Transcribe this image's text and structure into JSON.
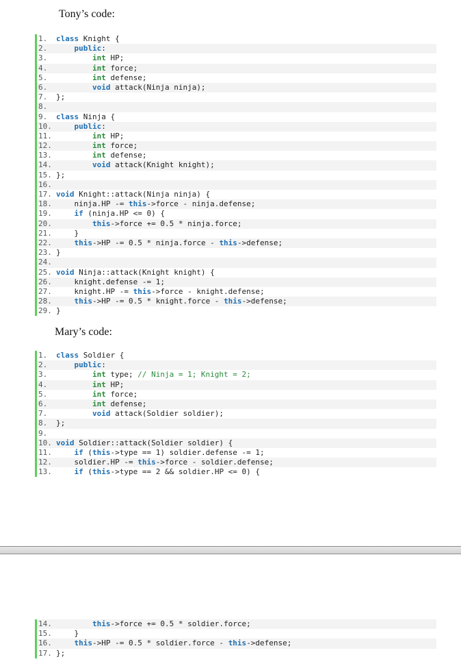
{
  "tony": {
    "title": "Tony’s code:",
    "start_line": 1,
    "lines": [
      [
        [
          "k",
          "class"
        ],
        [
          "t",
          " Knight {"
        ]
      ],
      [
        [
          "t",
          "    "
        ],
        [
          "k",
          "public"
        ],
        [
          "t",
          ":"
        ]
      ],
      [
        [
          "t",
          "        "
        ],
        [
          "y",
          "int"
        ],
        [
          "t",
          " HP;"
        ]
      ],
      [
        [
          "t",
          "        "
        ],
        [
          "y",
          "int"
        ],
        [
          "t",
          " force;"
        ]
      ],
      [
        [
          "t",
          "        "
        ],
        [
          "y",
          "int"
        ],
        [
          "t",
          " defense;"
        ]
      ],
      [
        [
          "t",
          "        "
        ],
        [
          "k",
          "void"
        ],
        [
          "t",
          " attack(Ninja ninja);"
        ]
      ],
      [
        [
          "t",
          "};"
        ]
      ],
      [],
      [
        [
          "k",
          "class"
        ],
        [
          "t",
          " Ninja {"
        ]
      ],
      [
        [
          "t",
          "    "
        ],
        [
          "k",
          "public"
        ],
        [
          "t",
          ":"
        ]
      ],
      [
        [
          "t",
          "        "
        ],
        [
          "y",
          "int"
        ],
        [
          "t",
          " HP;"
        ]
      ],
      [
        [
          "t",
          "        "
        ],
        [
          "y",
          "int"
        ],
        [
          "t",
          " force;"
        ]
      ],
      [
        [
          "t",
          "        "
        ],
        [
          "y",
          "int"
        ],
        [
          "t",
          " defense;"
        ]
      ],
      [
        [
          "t",
          "        "
        ],
        [
          "k",
          "void"
        ],
        [
          "t",
          " attack(Knight knight);"
        ]
      ],
      [
        [
          "t",
          "};"
        ]
      ],
      [],
      [
        [
          "k",
          "void"
        ],
        [
          "t",
          " Knight::attack(Ninja ninja) {"
        ]
      ],
      [
        [
          "t",
          "    ninja.HP -= "
        ],
        [
          "k",
          "this"
        ],
        [
          "t",
          "->force - ninja.defense;"
        ]
      ],
      [
        [
          "t",
          "    "
        ],
        [
          "k",
          "if"
        ],
        [
          "t",
          " (ninja.HP <= 0) {"
        ]
      ],
      [
        [
          "t",
          "        "
        ],
        [
          "k",
          "this"
        ],
        [
          "t",
          "->force += 0.5 * ninja.force;"
        ]
      ],
      [
        [
          "t",
          "    }"
        ]
      ],
      [
        [
          "t",
          "    "
        ],
        [
          "k",
          "this"
        ],
        [
          "t",
          "->HP -= 0.5 * ninja.force - "
        ],
        [
          "k",
          "this"
        ],
        [
          "t",
          "->defense;"
        ]
      ],
      [
        [
          "t",
          "}"
        ]
      ],
      [],
      [
        [
          "k",
          "void"
        ],
        [
          "t",
          " Ninja::attack(Knight knight) {"
        ]
      ],
      [
        [
          "t",
          "    knight.defense -= 1;"
        ]
      ],
      [
        [
          "t",
          "    knight.HP -= "
        ],
        [
          "k",
          "this"
        ],
        [
          "t",
          "->force - knight.defense;"
        ]
      ],
      [
        [
          "t",
          "    "
        ],
        [
          "k",
          "this"
        ],
        [
          "t",
          "->HP -= 0.5 * knight.force - "
        ],
        [
          "k",
          "this"
        ],
        [
          "t",
          "->defense;"
        ]
      ],
      [
        [
          "t",
          "}"
        ]
      ]
    ]
  },
  "mary": {
    "title": "Mary’s code:",
    "part1_start_line": 1,
    "part1": [
      [
        [
          "k",
          "class"
        ],
        [
          "t",
          " Soldier {"
        ]
      ],
      [
        [
          "t",
          "    "
        ],
        [
          "k",
          "public"
        ],
        [
          "t",
          ":"
        ]
      ],
      [
        [
          "t",
          "        "
        ],
        [
          "y",
          "int"
        ],
        [
          "t",
          " type; "
        ],
        [
          "c",
          "// Ninja = 1; Knight = 2;"
        ]
      ],
      [
        [
          "t",
          "        "
        ],
        [
          "y",
          "int"
        ],
        [
          "t",
          " HP;"
        ]
      ],
      [
        [
          "t",
          "        "
        ],
        [
          "y",
          "int"
        ],
        [
          "t",
          " force;"
        ]
      ],
      [
        [
          "t",
          "        "
        ],
        [
          "y",
          "int"
        ],
        [
          "t",
          " defense;"
        ]
      ],
      [
        [
          "t",
          "        "
        ],
        [
          "k",
          "void"
        ],
        [
          "t",
          " attack(Soldier soldier);"
        ]
      ],
      [
        [
          "t",
          "};"
        ]
      ],
      [],
      [
        [
          "k",
          "void"
        ],
        [
          "t",
          " Soldier::attack(Soldier soldier) {"
        ]
      ],
      [
        [
          "t",
          "    "
        ],
        [
          "k",
          "if"
        ],
        [
          "t",
          " ("
        ],
        [
          "k",
          "this"
        ],
        [
          "t",
          "->type == 1) soldier.defense -= 1;"
        ]
      ],
      [
        [
          "t",
          "    soldier.HP -= "
        ],
        [
          "k",
          "this"
        ],
        [
          "t",
          "->force - soldier.defense;"
        ]
      ],
      [
        [
          "t",
          "    "
        ],
        [
          "k",
          "if"
        ],
        [
          "t",
          " ("
        ],
        [
          "k",
          "this"
        ],
        [
          "t",
          "->type == 2 && soldier.HP <= 0) {"
        ]
      ]
    ],
    "part2_start_line": 14,
    "part2": [
      [
        [
          "t",
          "        "
        ],
        [
          "k",
          "this"
        ],
        [
          "t",
          "->force += 0.5 * soldier.force;"
        ]
      ],
      [
        [
          "t",
          "    }"
        ]
      ],
      [
        [
          "t",
          "    "
        ],
        [
          "k",
          "this"
        ],
        [
          "t",
          "->HP -= 0.5 * soldier.force - "
        ],
        [
          "k",
          "this"
        ],
        [
          "t",
          "->defense;"
        ]
      ],
      [
        [
          "t",
          "};"
        ]
      ]
    ]
  },
  "colors": {
    "keyword": "#1f6fb2",
    "type": "#2a8a3a",
    "comment": "#2a8a3a",
    "gutter_bar": "#5bcf5b",
    "alt_row": "#f3f3f3"
  }
}
